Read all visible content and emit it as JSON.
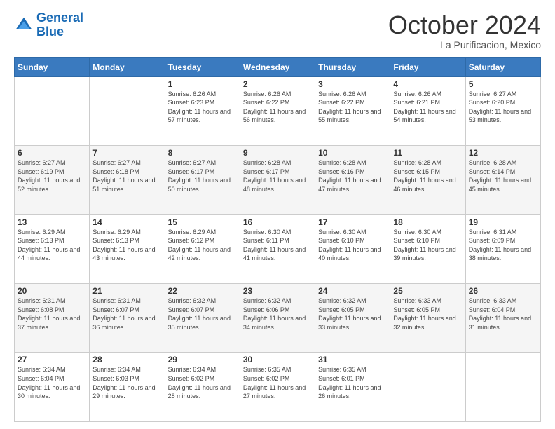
{
  "header": {
    "logo_line1": "General",
    "logo_line2": "Blue",
    "month": "October 2024",
    "location": "La Purificacion, Mexico"
  },
  "days_of_week": [
    "Sunday",
    "Monday",
    "Tuesday",
    "Wednesday",
    "Thursday",
    "Friday",
    "Saturday"
  ],
  "weeks": [
    [
      {
        "day": "",
        "sunrise": "",
        "sunset": "",
        "daylight": ""
      },
      {
        "day": "",
        "sunrise": "",
        "sunset": "",
        "daylight": ""
      },
      {
        "day": "1",
        "sunrise": "Sunrise: 6:26 AM",
        "sunset": "Sunset: 6:23 PM",
        "daylight": "Daylight: 11 hours and 57 minutes."
      },
      {
        "day": "2",
        "sunrise": "Sunrise: 6:26 AM",
        "sunset": "Sunset: 6:22 PM",
        "daylight": "Daylight: 11 hours and 56 minutes."
      },
      {
        "day": "3",
        "sunrise": "Sunrise: 6:26 AM",
        "sunset": "Sunset: 6:22 PM",
        "daylight": "Daylight: 11 hours and 55 minutes."
      },
      {
        "day": "4",
        "sunrise": "Sunrise: 6:26 AM",
        "sunset": "Sunset: 6:21 PM",
        "daylight": "Daylight: 11 hours and 54 minutes."
      },
      {
        "day": "5",
        "sunrise": "Sunrise: 6:27 AM",
        "sunset": "Sunset: 6:20 PM",
        "daylight": "Daylight: 11 hours and 53 minutes."
      }
    ],
    [
      {
        "day": "6",
        "sunrise": "Sunrise: 6:27 AM",
        "sunset": "Sunset: 6:19 PM",
        "daylight": "Daylight: 11 hours and 52 minutes."
      },
      {
        "day": "7",
        "sunrise": "Sunrise: 6:27 AM",
        "sunset": "Sunset: 6:18 PM",
        "daylight": "Daylight: 11 hours and 51 minutes."
      },
      {
        "day": "8",
        "sunrise": "Sunrise: 6:27 AM",
        "sunset": "Sunset: 6:17 PM",
        "daylight": "Daylight: 11 hours and 50 minutes."
      },
      {
        "day": "9",
        "sunrise": "Sunrise: 6:28 AM",
        "sunset": "Sunset: 6:17 PM",
        "daylight": "Daylight: 11 hours and 48 minutes."
      },
      {
        "day": "10",
        "sunrise": "Sunrise: 6:28 AM",
        "sunset": "Sunset: 6:16 PM",
        "daylight": "Daylight: 11 hours and 47 minutes."
      },
      {
        "day": "11",
        "sunrise": "Sunrise: 6:28 AM",
        "sunset": "Sunset: 6:15 PM",
        "daylight": "Daylight: 11 hours and 46 minutes."
      },
      {
        "day": "12",
        "sunrise": "Sunrise: 6:28 AM",
        "sunset": "Sunset: 6:14 PM",
        "daylight": "Daylight: 11 hours and 45 minutes."
      }
    ],
    [
      {
        "day": "13",
        "sunrise": "Sunrise: 6:29 AM",
        "sunset": "Sunset: 6:13 PM",
        "daylight": "Daylight: 11 hours and 44 minutes."
      },
      {
        "day": "14",
        "sunrise": "Sunrise: 6:29 AM",
        "sunset": "Sunset: 6:13 PM",
        "daylight": "Daylight: 11 hours and 43 minutes."
      },
      {
        "day": "15",
        "sunrise": "Sunrise: 6:29 AM",
        "sunset": "Sunset: 6:12 PM",
        "daylight": "Daylight: 11 hours and 42 minutes."
      },
      {
        "day": "16",
        "sunrise": "Sunrise: 6:30 AM",
        "sunset": "Sunset: 6:11 PM",
        "daylight": "Daylight: 11 hours and 41 minutes."
      },
      {
        "day": "17",
        "sunrise": "Sunrise: 6:30 AM",
        "sunset": "Sunset: 6:10 PM",
        "daylight": "Daylight: 11 hours and 40 minutes."
      },
      {
        "day": "18",
        "sunrise": "Sunrise: 6:30 AM",
        "sunset": "Sunset: 6:10 PM",
        "daylight": "Daylight: 11 hours and 39 minutes."
      },
      {
        "day": "19",
        "sunrise": "Sunrise: 6:31 AM",
        "sunset": "Sunset: 6:09 PM",
        "daylight": "Daylight: 11 hours and 38 minutes."
      }
    ],
    [
      {
        "day": "20",
        "sunrise": "Sunrise: 6:31 AM",
        "sunset": "Sunset: 6:08 PM",
        "daylight": "Daylight: 11 hours and 37 minutes."
      },
      {
        "day": "21",
        "sunrise": "Sunrise: 6:31 AM",
        "sunset": "Sunset: 6:07 PM",
        "daylight": "Daylight: 11 hours and 36 minutes."
      },
      {
        "day": "22",
        "sunrise": "Sunrise: 6:32 AM",
        "sunset": "Sunset: 6:07 PM",
        "daylight": "Daylight: 11 hours and 35 minutes."
      },
      {
        "day": "23",
        "sunrise": "Sunrise: 6:32 AM",
        "sunset": "Sunset: 6:06 PM",
        "daylight": "Daylight: 11 hours and 34 minutes."
      },
      {
        "day": "24",
        "sunrise": "Sunrise: 6:32 AM",
        "sunset": "Sunset: 6:05 PM",
        "daylight": "Daylight: 11 hours and 33 minutes."
      },
      {
        "day": "25",
        "sunrise": "Sunrise: 6:33 AM",
        "sunset": "Sunset: 6:05 PM",
        "daylight": "Daylight: 11 hours and 32 minutes."
      },
      {
        "day": "26",
        "sunrise": "Sunrise: 6:33 AM",
        "sunset": "Sunset: 6:04 PM",
        "daylight": "Daylight: 11 hours and 31 minutes."
      }
    ],
    [
      {
        "day": "27",
        "sunrise": "Sunrise: 6:34 AM",
        "sunset": "Sunset: 6:04 PM",
        "daylight": "Daylight: 11 hours and 30 minutes."
      },
      {
        "day": "28",
        "sunrise": "Sunrise: 6:34 AM",
        "sunset": "Sunset: 6:03 PM",
        "daylight": "Daylight: 11 hours and 29 minutes."
      },
      {
        "day": "29",
        "sunrise": "Sunrise: 6:34 AM",
        "sunset": "Sunset: 6:02 PM",
        "daylight": "Daylight: 11 hours and 28 minutes."
      },
      {
        "day": "30",
        "sunrise": "Sunrise: 6:35 AM",
        "sunset": "Sunset: 6:02 PM",
        "daylight": "Daylight: 11 hours and 27 minutes."
      },
      {
        "day": "31",
        "sunrise": "Sunrise: 6:35 AM",
        "sunset": "Sunset: 6:01 PM",
        "daylight": "Daylight: 11 hours and 26 minutes."
      },
      {
        "day": "",
        "sunrise": "",
        "sunset": "",
        "daylight": ""
      },
      {
        "day": "",
        "sunrise": "",
        "sunset": "",
        "daylight": ""
      }
    ]
  ]
}
